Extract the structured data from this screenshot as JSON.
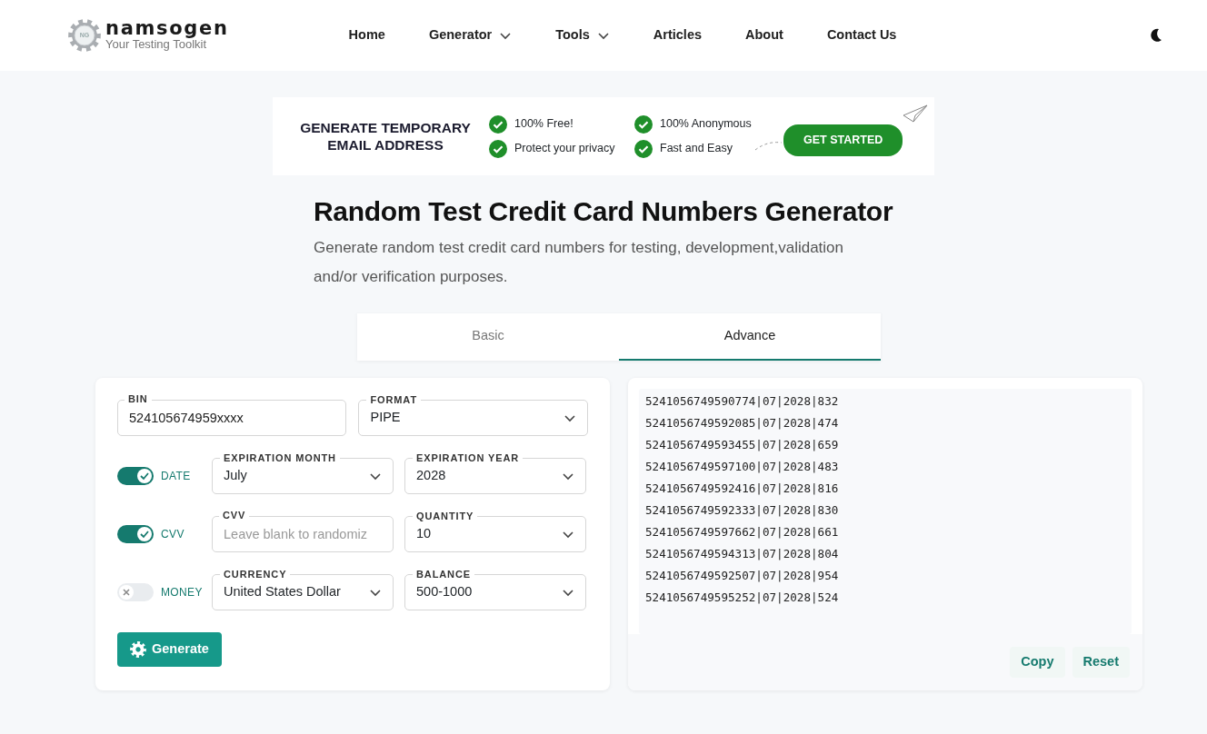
{
  "header": {
    "logo_mark": "NG",
    "brand": "namsogen",
    "tagline": "Your Testing Toolkit",
    "nav": [
      {
        "label": "Home",
        "dropdown": false
      },
      {
        "label": "Generator",
        "dropdown": true
      },
      {
        "label": "Tools",
        "dropdown": true
      },
      {
        "label": "Articles",
        "dropdown": false
      },
      {
        "label": "About",
        "dropdown": false
      },
      {
        "label": "Contact Us",
        "dropdown": false
      }
    ]
  },
  "banner": {
    "heading": "GENERATE TEMPORARY EMAIL ADDRESS",
    "features": [
      "100% Free!",
      "100% Anonymous",
      "Protect your privacy",
      "Fast and Easy"
    ],
    "button": "GET STARTED"
  },
  "page": {
    "title": "Random Test Credit Card Numbers Generator",
    "description": "Generate random test credit card numbers for testing, development,validation and/or verification purposes."
  },
  "tabs": [
    {
      "label": "Basic",
      "selected": false
    },
    {
      "label": "Advance",
      "selected": true
    }
  ],
  "form": {
    "top_fields": [
      {
        "kind": "input",
        "label": "BIN",
        "value": "524105674959xxxx"
      },
      {
        "kind": "select",
        "label": "FORMAT",
        "value": "PIPE"
      }
    ],
    "rows": [
      {
        "toggle": {
          "label": "DATE",
          "on": true
        },
        "fields": [
          {
            "kind": "select",
            "label": "EXPIRATION MONTH",
            "value": "July"
          },
          {
            "kind": "select",
            "label": "EXPIRATION YEAR",
            "value": "2028"
          }
        ]
      },
      {
        "toggle": {
          "label": "CVV",
          "on": true
        },
        "fields": [
          {
            "kind": "input",
            "label": "CVV",
            "placeholder": "Leave blank to randomiz"
          },
          {
            "kind": "select",
            "label": "QUANTITY",
            "value": "10"
          }
        ]
      },
      {
        "toggle": {
          "label": "MONEY",
          "on": false
        },
        "fields": [
          {
            "kind": "select",
            "label": "CURRENCY",
            "value": "United States Dollar"
          },
          {
            "kind": "select",
            "label": "BALANCE",
            "value": "500-1000"
          }
        ]
      }
    ],
    "generate_button": "Generate"
  },
  "output": {
    "lines": [
      "5241056749590774|07|2028|832",
      "5241056749592085|07|2028|474",
      "5241056749593455|07|2028|659",
      "5241056749597100|07|2028|483",
      "5241056749592416|07|2028|816",
      "5241056749592333|07|2028|830",
      "5241056749597662|07|2028|661",
      "5241056749594313|07|2028|804",
      "5241056749592507|07|2028|954",
      "5241056749595252|07|2028|524"
    ],
    "buttons": [
      "Copy",
      "Reset"
    ]
  }
}
